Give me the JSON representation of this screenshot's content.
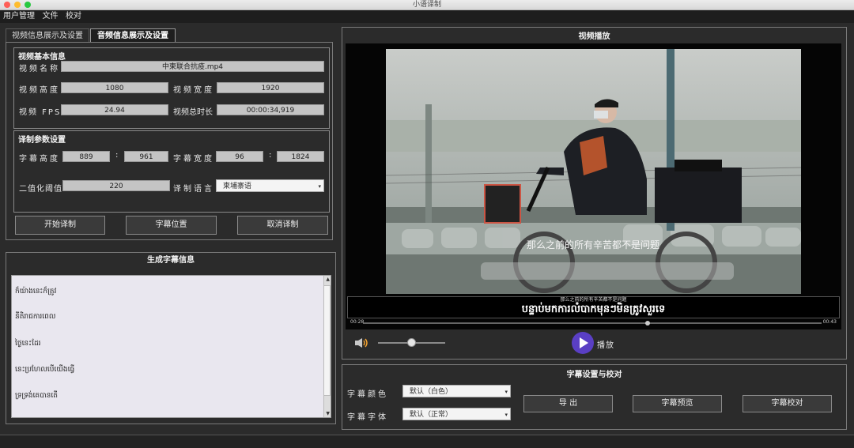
{
  "window": {
    "title": "小语译制"
  },
  "menu": [
    "用户管理",
    "文件",
    "校对"
  ],
  "tabs": [
    {
      "label": "视频信息展示及设置",
      "active": false
    },
    {
      "label": "音频信息展示及设置",
      "active": true
    }
  ],
  "video_info": {
    "title": "视频基本信息",
    "name_label": "视频名称",
    "name_value": "中柬联合抗疫.mp4",
    "height_label": "视频高度",
    "height_value": "1080",
    "width_label": "视频宽度",
    "width_value": "1920",
    "fps_label": "视频 FPS",
    "fps_value": "24.94",
    "duration_label": "视频总时长",
    "duration_value": "00:00:34,919"
  },
  "params": {
    "title": "译制参数设置",
    "sub_height_label": "字幕高度",
    "sub_height_from": "889",
    "sub_height_to": "961",
    "sub_width_label": "字幕宽度",
    "sub_width_from": "96",
    "sub_width_to": "1824",
    "colon": ":",
    "threshold_label": "二值化阈值",
    "threshold_value": "220",
    "language_label": "译制语言",
    "language_value": "柬埔寨语"
  },
  "actions": {
    "start": "开始译制",
    "position": "字幕位置",
    "cancel": "取消译制"
  },
  "generated": {
    "title": "生成字幕信息",
    "lines": [
      "ក៏យ៉ាងនេះក៏ត្រូវ",
      "នីតិរាជការពេល",
      "ថ្ងៃនេះដែរ",
      "នេះប្រហែលបើយើងធ្វើ",
      "ទ្រទ្រង់គេបានតើ"
    ]
  },
  "player": {
    "title": "视频播放",
    "burned_subtitle": "那么之前的所有辛苦都不是问题",
    "sub_small": "那么之前的所有辛苦都不是问题",
    "sub_big": "បន្ទាប់មកការលំបាកមុនៗមិនត្រូវសួរទេ",
    "time_start": "00:28",
    "time_end": "00:43",
    "progress": 0.62,
    "volume": 0.5,
    "play_label": "播放"
  },
  "subtitle_settings": {
    "title": "字幕设置与校对",
    "color_label": "字幕颜色",
    "color_value": "默认（白色）",
    "font_label": "字幕字体",
    "font_value": "默认（正常）",
    "export_label": "导 出",
    "preview_label": "字幕预览",
    "proof_label": "字幕校对"
  },
  "colors": {
    "accent": "#5a3fc4",
    "panel": "#2b2b2b",
    "field": "#c4c4c4"
  }
}
